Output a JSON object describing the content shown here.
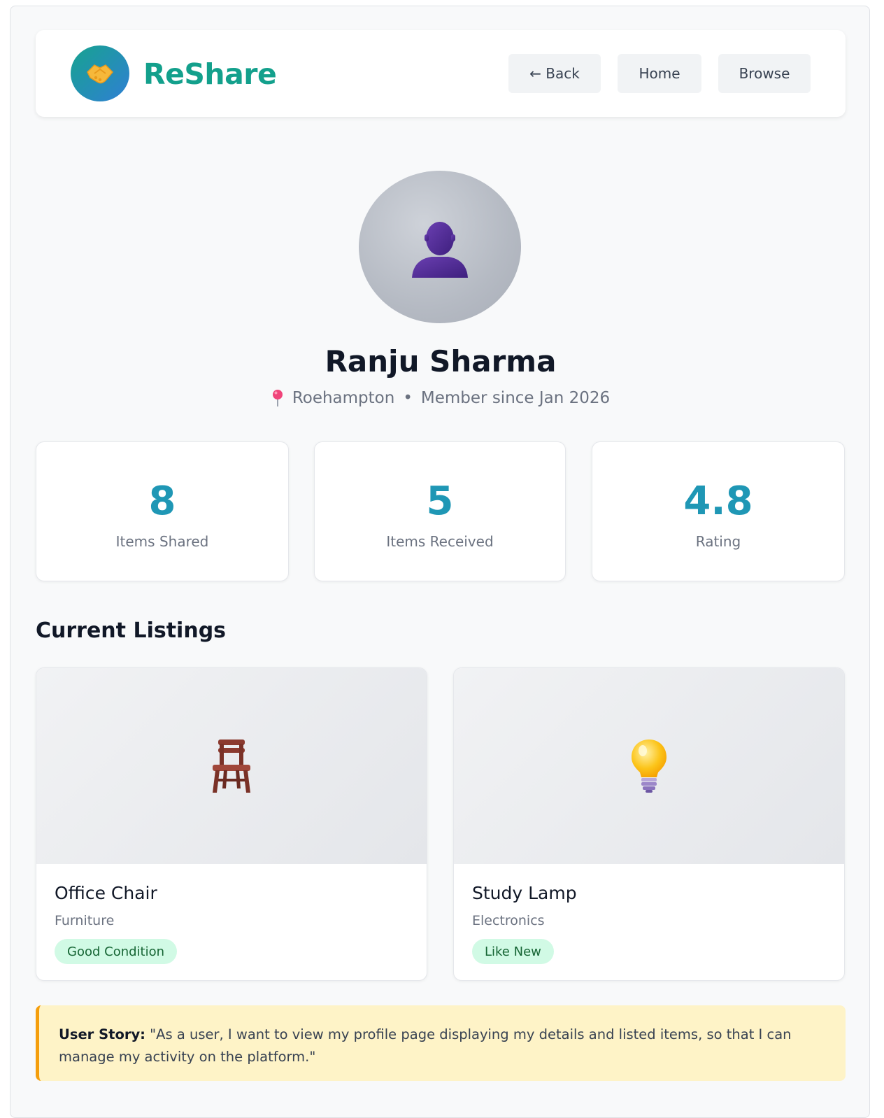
{
  "header": {
    "brand": "ReShare",
    "nav": {
      "back": "← Back",
      "home": "Home",
      "browse": "Browse"
    }
  },
  "profile": {
    "name": "Ranju Sharma",
    "location": "Roehampton",
    "separator": "•",
    "member_since": "Member since Jan 2026"
  },
  "stats": [
    {
      "value": "8",
      "label": "Items Shared"
    },
    {
      "value": "5",
      "label": "Items Received"
    },
    {
      "value": "4.8",
      "label": "Rating"
    }
  ],
  "listings_section": {
    "title": "Current Listings"
  },
  "listings": [
    {
      "icon": "chair-icon",
      "title": "Office Chair",
      "category": "Furniture",
      "condition": "Good Condition"
    },
    {
      "icon": "light-bulb-icon",
      "title": "Study Lamp",
      "category": "Electronics",
      "condition": "Like New"
    }
  ],
  "user_story": {
    "label": "User Story:",
    "text": "\"As a user, I want to view my profile page displaying my details and listed items, so that I can manage my activity on the platform.\""
  },
  "colors": {
    "brand": "#13a08c",
    "stat_value": "#1f97b5",
    "badge_bg": "#d1fae5",
    "story_bg": "#fef3c7",
    "story_border": "#f59e0b"
  }
}
